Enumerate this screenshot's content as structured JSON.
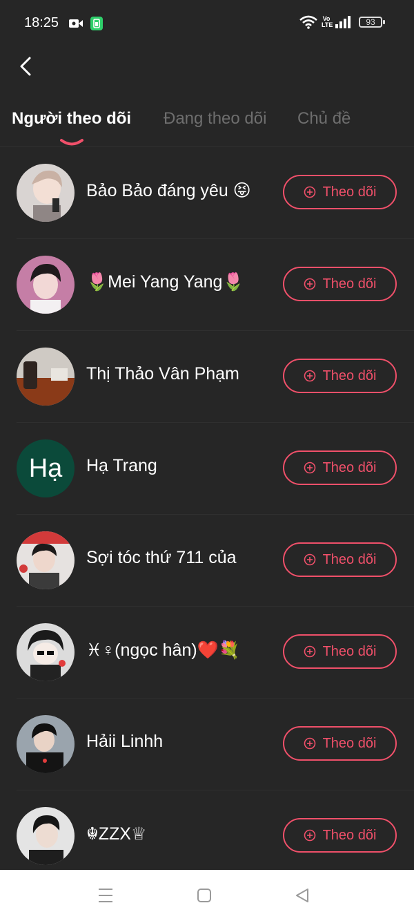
{
  "status_bar": {
    "time": "18:25",
    "battery": "93",
    "volte_top": "Vo",
    "volte_bottom": "LTE"
  },
  "tabs": [
    {
      "label": "Người theo dõi",
      "active": true
    },
    {
      "label": "Đang theo dõi",
      "active": false
    },
    {
      "label": "Chủ đề",
      "active": false
    }
  ],
  "colors": {
    "background": "#262626",
    "accent": "#f0506a",
    "inactive_tab": "#6e6e6e"
  },
  "follow_label": "Theo dõi",
  "users": [
    {
      "name": "Bảo Bảo đáng yêu 😝",
      "avatar_icon": "anime-boy-avatar-icon"
    },
    {
      "name": "🌷Mei Yang Yang🌷",
      "avatar_icon": "photo-avatar-icon"
    },
    {
      "name": "Thị Thảo Vân Phạm",
      "avatar_icon": "room-photo-avatar-icon"
    },
    {
      "name": "Hạ Trang",
      "avatar_icon": "letter-avatar-icon",
      "avatar_text": "Hạ",
      "avatar_color": "#0b4a3a"
    },
    {
      "name": "Sợi tóc thứ 711 của",
      "avatar_icon": "photo-avatar-icon"
    },
    {
      "name": "♓♀(ngọc hân)❤️💐",
      "avatar_icon": "cartoon-avatar-icon"
    },
    {
      "name": "Hảii Linhh",
      "avatar_icon": "photo-avatar-icon"
    },
    {
      "name": "☬ZZX♕",
      "avatar_icon": "photo-avatar-icon"
    }
  ],
  "nav_bar": {
    "icons": [
      "menu-icon",
      "home-square-icon",
      "back-triangle-icon"
    ]
  }
}
